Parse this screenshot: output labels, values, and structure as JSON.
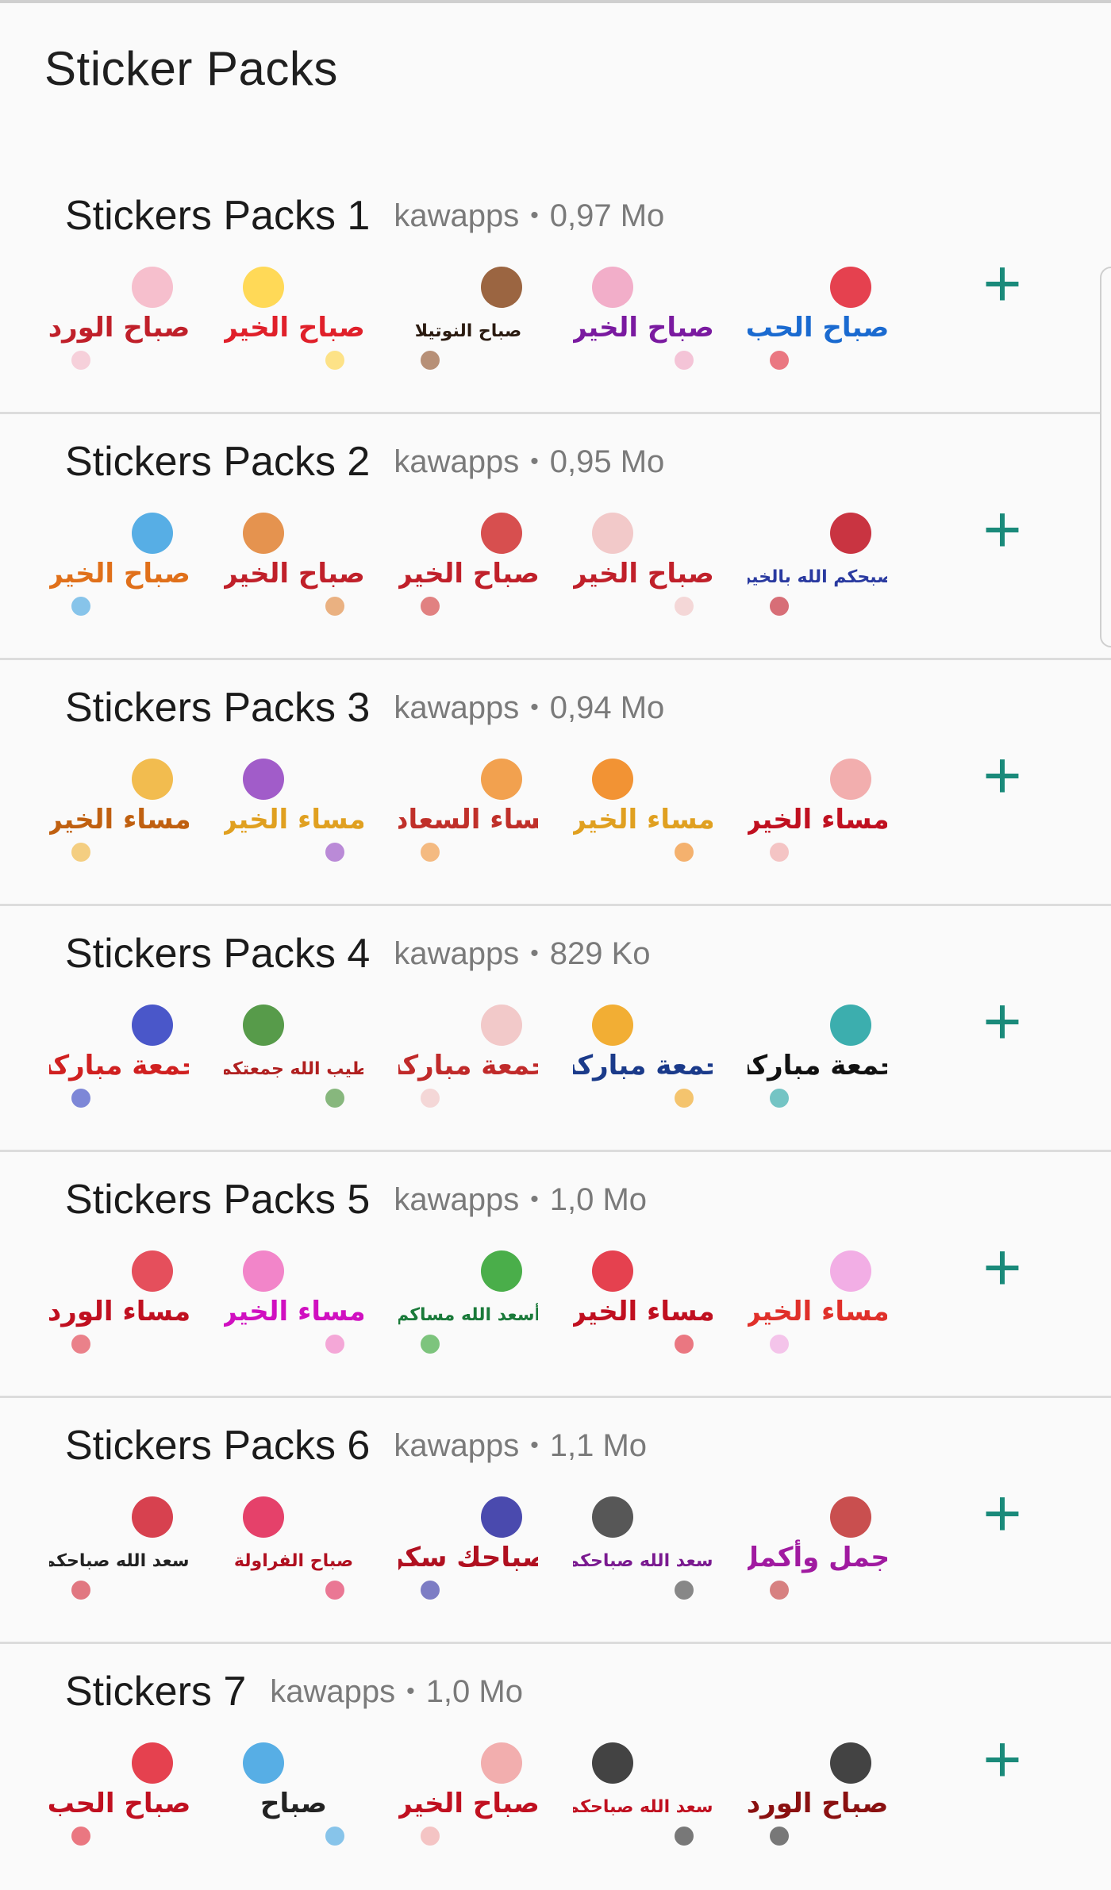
{
  "screen": {
    "title": "Sticker Packs"
  },
  "packs": [
    {
      "name": "Stickers Packs 1",
      "author": "kawapps",
      "size": "0,97 Mo",
      "stickers": [
        {
          "caption": "صباح الورد",
          "color": "#c0202a",
          "accent": "#f4b4c4"
        },
        {
          "caption": "صباح الخير",
          "color": "#e0202a",
          "accent": "#ffd23a"
        },
        {
          "caption": "صباح النوتيلا",
          "color": "#2a1a10",
          "accent": "#8a4a20"
        },
        {
          "caption": "صباح الخير",
          "color": "#7a1aa0",
          "accent": "#f0a0c0"
        },
        {
          "caption": "صباح الحب",
          "color": "#1a6ad0",
          "accent": "#e02030"
        }
      ]
    },
    {
      "name": "Stickers Packs 2",
      "author": "kawapps",
      "size": "0,95 Mo",
      "stickers": [
        {
          "caption": "صباح الخير",
          "color": "#e0701a",
          "accent": "#3aa0e0"
        },
        {
          "caption": "صباح الخير",
          "color": "#c0202a",
          "accent": "#e08030"
        },
        {
          "caption": "صباح الخير",
          "color": "#c0202a",
          "accent": "#d03030"
        },
        {
          "caption": "صباح الخير",
          "color": "#c0202a",
          "accent": "#f0c0c0"
        },
        {
          "caption": "صبحكم الله بالخير",
          "color": "#2a3aa0",
          "accent": "#c01020"
        }
      ]
    },
    {
      "name": "Stickers Packs 3",
      "author": "kawapps",
      "size": "0,94 Mo",
      "stickers": [
        {
          "caption": "مساء الخير",
          "color": "#c06010",
          "accent": "#f0b030"
        },
        {
          "caption": "مساء الخير",
          "color": "#e0a020",
          "accent": "#9040c0"
        },
        {
          "caption": "مساء السعادة",
          "color": "#c0302a",
          "accent": "#f09030"
        },
        {
          "caption": "مساء الخير",
          "color": "#e0a020",
          "accent": "#f08010"
        },
        {
          "caption": "مساء الخير",
          "color": "#c01020",
          "accent": "#f0a0a0"
        }
      ]
    },
    {
      "name": "Stickers Packs 4",
      "author": "kawapps",
      "size": "829 Ko",
      "stickers": [
        {
          "caption": "جمعة مباركة",
          "color": "#d02020",
          "accent": "#2a3ac0"
        },
        {
          "caption": "طيب الله جمعتكم",
          "color": "#b02020",
          "accent": "#3a8a2a"
        },
        {
          "caption": "جمعة مباركة",
          "color": "#c02a2a",
          "accent": "#f0c0c0"
        },
        {
          "caption": "جمعة مباركة",
          "color": "#1a3a8a",
          "accent": "#f0a010"
        },
        {
          "caption": "جمعة مباركة",
          "color": "#111111",
          "accent": "#1aa0a0"
        }
      ]
    },
    {
      "name": "Stickers Packs 5",
      "author": "kawapps",
      "size": "1,0 Mo",
      "stickers": [
        {
          "caption": "مساء الورد",
          "color": "#c01020",
          "accent": "#e03040"
        },
        {
          "caption": "مساء الخير",
          "color": "#d010c0",
          "accent": "#f070c0"
        },
        {
          "caption": "أسعد الله مساكم",
          "color": "#1a7a3a",
          "accent": "#2aa02a"
        },
        {
          "caption": "مساء الخير",
          "color": "#c01020",
          "accent": "#e02030"
        },
        {
          "caption": "مساء الخير",
          "color": "#e0302a",
          "accent": "#f0a0e0"
        }
      ]
    },
    {
      "name": "Stickers Packs 6",
      "author": "kawapps",
      "size": "1,1 Mo",
      "stickers": [
        {
          "caption": "أسعد الله صباحكم",
          "color": "#222222",
          "accent": "#d02030"
        },
        {
          "caption": "صباح الفراولة",
          "color": "#b01020",
          "accent": "#e02050"
        },
        {
          "caption": "صباحك سكر",
          "color": "#b01020",
          "accent": "#2a2aa0"
        },
        {
          "caption": "أسعد الله صباحكم",
          "color": "#7a1a90",
          "accent": "#3a3a3a"
        },
        {
          "caption": "أجمل وأكمل",
          "color": "#a01aa0",
          "accent": "#c03030"
        }
      ]
    },
    {
      "name": "Stickers 7",
      "author": "kawapps",
      "size": "1,0 Mo",
      "stickers": [
        {
          "caption": "صباح الحب",
          "color": "#c01020",
          "accent": "#e02030"
        },
        {
          "caption": "صباح",
          "color": "#222222",
          "accent": "#3aa0e0"
        },
        {
          "caption": "صباح الخير",
          "color": "#c01020",
          "accent": "#f0a0a0"
        },
        {
          "caption": "أسعد الله صباحكم",
          "color": "#c01020",
          "accent": "#222222"
        },
        {
          "caption": "صباح الورد",
          "color": "#8a1010",
          "accent": "#222222"
        }
      ]
    }
  ],
  "add_label": "+",
  "accent_color": "#1a8a7a"
}
